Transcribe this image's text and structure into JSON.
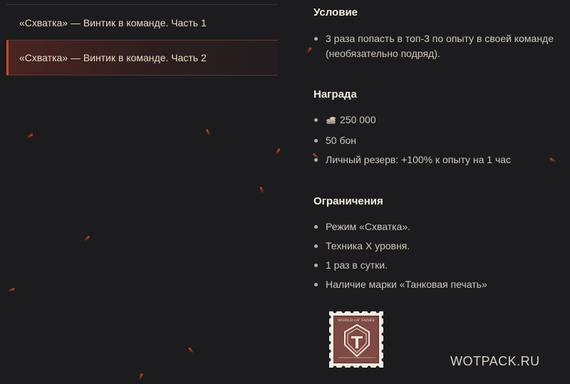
{
  "missions": [
    {
      "label": "«Схватка» — Винтик в команде. Часть 1",
      "active": false
    },
    {
      "label": "«Схватка» — Винтик в команде. Часть 2",
      "active": true
    }
  ],
  "condition": {
    "title": "Условие",
    "items": [
      "3 раза попасть в топ-3 по опыту в своей команде (необязательно подряд)."
    ]
  },
  "reward": {
    "title": "Награда",
    "credits_icon": "credits-icon",
    "items": [
      "250 000",
      "50 бон",
      "Личный резерв: +100% к опыту на 1 час"
    ]
  },
  "restrictions": {
    "title": "Ограничения",
    "items": [
      "Режим «Схватка».",
      "Техника X уровня.",
      "1 раз в сутки.",
      "Наличие марки «Танковая печать»"
    ]
  },
  "stamp": {
    "text": "WORLD OF TANKS",
    "icon": "tank-stamp-icon"
  },
  "watermark": "WOTPACK.RU",
  "colors": {
    "accent": "#c24a2e",
    "background": "#1c1b1d",
    "text": "#cfc8bd"
  }
}
